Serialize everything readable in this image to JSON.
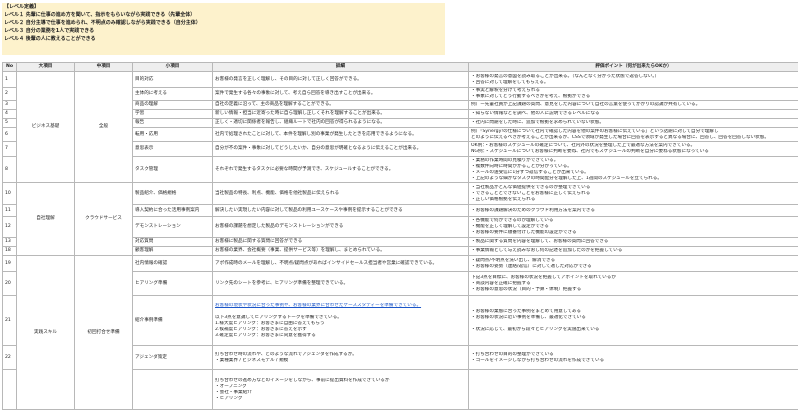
{
  "legend": {
    "title": "【レベル定義】",
    "levels": [
      "レベル１ 先輩に仕事の進め方を聞いて、指示をもらいながら実践できる（先輩全体）",
      "レベル２ 自分主導で仕事を進められ、不明点のみ確認しながら実践できる（自分主体）",
      "レベル３ 自分の業務を1人で実践できる",
      "レベル４ 後輩の人に教えることができる"
    ]
  },
  "headers": [
    "No",
    "大項目",
    "中項目",
    "小項目",
    "詳細",
    "評価ポイント（何が出来たらOKか）"
  ],
  "categories": {
    "business_basics": "ビジネス基礎",
    "common": "全般",
    "own_product": "自社理解",
    "cloud_service": "クラウドサービス",
    "practical": "実践スキル",
    "first_sales": "初回打合せ準備"
  },
  "rows": [
    {
      "no": "1",
      "item": "目的対応",
      "detail": "お客様の発言を正しく理解し、その目的に対して正しく回答ができる。",
      "points": [
        "・お客様の発言の意図を読み取ることが出来る。（なんとなく分かった状態で返答しない。）",
        "・回答に対して理解をしてもらえる。"
      ]
    },
    {
      "no": "2",
      "item": "主体的に考える",
      "detail": "案件で発生する各々の事象に対して、考え自ら回答を導き出すことが出来る。",
      "points": [
        "・事実と解釈を分けて考えられる",
        "・事象に対してどう行動するべきかを考え、根拠ができる"
      ]
    },
    {
      "no": "3",
      "item": "商品の理解",
      "detail": "自社の定義に沿って、主の商品を理解することができる。",
      "points": [
        "例）ー先輩社員が上記課題の質問、意見をした内容について自社の言葉を使ってかかりの認識が共有している。"
      ]
    },
    {
      "no": "4",
      "item": "学習",
      "detail": "新しい情報・担当に近寄った時に自ら理解し正しくそれを理解することが出来る。",
      "points": [
        "・知らない情報などを調べ、他の人に説明できるレベルになる"
      ]
    },
    {
      "no": "5",
      "item": "報告",
      "detail": "正しく・適切に関係者を報告し、組織ルートで社内の回答が得られるようになる。",
      "points": [
        "・社内に問題をした時に、追加で根拠を求められていない状態。"
      ]
    },
    {
      "no": "6",
      "item": "転用・応用",
      "detail": "社内で処理されたことに対して、本件を理解し別の事業が発生したときを応用できるようになる。",
      "points": [
        "例）「Synergy!の仕様について社内で確認した内容を他の案件のお客様に伝えている」という話題に対して自分で理解し",
        "どのように伝えるべきか考えることが出来るか、CSSで領域が発生した場合に回答を表示すると異なる場合に、回答し、回答を回答しない状態。"
      ]
    },
    {
      "no": "7",
      "item": "意思表示",
      "detail": "自分が不の案件・事象に対してどうしたいか、自分の意思が明確となるように伝えることが出来る。",
      "points": [
        "OK例：・お客様のスケジュールの確定について、社内外の状況を整理した上で最適な方法を案内できている。",
        "NG例：・スケジュールについてお客様に判断を委ね、社内でもスケジュールの判断を自分に委ねる状態になっている"
      ]
    },
    {
      "no": "8",
      "item": "タスク管理",
      "detail": "それぞれで発生するタスクに必要な時間が予測でき、スケジュールすることができる。",
      "points": [
        "・業務の作業時間の見積りができている。",
        "・複数件向時に時間がかることが分かっている。",
        "・メールの送受信に1分ずつ返信することが出来ている。",
        "・上記のような細かなタスクの時間配分を理解した上、1週間のスケジュールを立てられる。"
      ]
    },
    {
      "no": "10",
      "item": "製品紹介、価格規格",
      "detail": "当社製品の特長、利点、機能、価格を他社製品に伝えられる",
      "points": [
        "・当社製品がどんな価値提供をできるのか整理できている",
        "・できることとできないことをお客様に正しく伝えられる",
        "・正しい価格根拠を伝えられる"
      ]
    },
    {
      "no": "11",
      "item": "導入契約に合った活用事例案内",
      "detail": "解決したい実現したい内容に対して製品の利用ユースケースや事例を提示することができる",
      "points": [
        "・お客様の課題解決のためのクラウド利用方法を案内できる"
      ]
    },
    {
      "no": "12",
      "item": "デモンストレーション",
      "detail": "お客様の課題を想定した製品のデモンストレーションができる",
      "points": [
        "・各機能で何ができるのか理解している",
        "・機能を正しく理解して設定ができる",
        "・お客様の要件に順番付けした機能の設定ができる"
      ]
    },
    {
      "no": "13",
      "item": "対応質問",
      "detail": "お客様に製品に関する質問に回答ができる",
      "points": [
        "・製品に関する質問を内容を理解して、お客様の質問に回答できる"
      ]
    },
    {
      "no": "18",
      "item": "顧客理解",
      "detail": "お客様の業界、会社概要（事業、提供サービス等）を理解し、まとめられている。",
      "points": [
        "・事業情報として与え読みなおし何の記述を追加したのかを把握している",
        "・お客様がいつどのように業務を行ったのか、お客様にご説明できる"
      ]
    },
    {
      "no": "19",
      "item": "社内情報の確認",
      "detail": "アポ作成時のメールを理解し、不明点/疑問点があればインサイドセールス担当者や営業に確認できている。",
      "points": [
        "・疑問点/不明点を洗い出し、解消できる",
        "・お客様の姿勢（連絡/返信）に対して適した対応ができる",
        "・お客様の情報で疑問点/不明点を確認し、会話に活用できる"
      ]
    },
    {
      "no": "20",
      "item": "ヒアリング準備",
      "detail": "リンク先のシートを参考に、ヒアリング準備を整理できている。",
      "detail_link": true,
      "points": [
        "下記3点を目標に、お客様の状況を把握してアポイントを取れているか",
        "・商談内容を正確に把握する",
        "・お客様の意思の状況（目的・予算・体制）把握する"
      ]
    },
    {
      "no": "21",
      "item": "紹介事例準備",
      "detail": "お客様の現状や状況に合った事例や、お客様の業界に合わせたケーススタディーを準備できている。",
      "points": [
        "・お客様の業態に合った事例をまとめて用意してある",
        "・お客様の状況に近い事例を準備し、最適化できている"
      ]
    },
    {
      "no": "22",
      "item": "アジェンダ策定",
      "detail": "打ち合わせ時の流れや、どのような流れでアジェンダを作成するか。",
      "points": [
        "・打ち合わせの目的の整理ができている",
        "・ゴールをイメージしながら打ち合わせの流れを作成できている"
      ]
    }
  ],
  "hearing_notes": [
    "以下3点を意識してヒアリングするトークを準備できている。",
    "1.様大度ヒアリング：お客さまに自由に答えてもらう",
    "2.候補度ヒアリング：お客さまに答えを示す",
    "3.確定度ヒアリング：お客さまに同意を獲得する"
  ],
  "hearing_points_extra": [
    "・状況に応じて、最初から段々とヒアリングを実施出来ている"
  ],
  "case_notes": [
    "・業種業界 / ビジネスモデル / 規模"
  ],
  "agenda_notes": [
    "打ち合わせの進め方などのイメージをしながら、事前に提出資料を作成できているか",
    "・オープニング",
    "・会社・事業紹介",
    "・ヒアリング"
  ]
}
